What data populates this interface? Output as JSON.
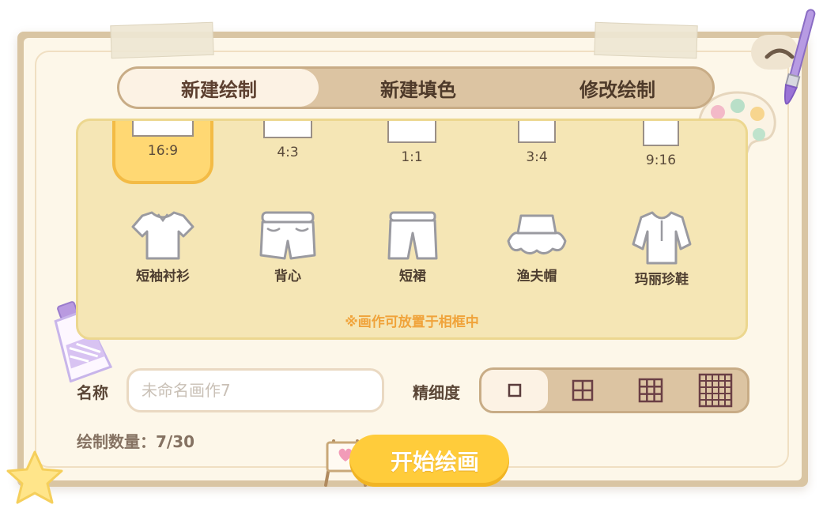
{
  "tabs": [
    {
      "label": "新建绘制",
      "active": true
    },
    {
      "label": "新建填色",
      "active": false
    },
    {
      "label": "修改绘制",
      "active": false
    }
  ],
  "ratios": [
    {
      "label": "16:9",
      "selected": true
    },
    {
      "label": "4:3",
      "selected": false
    },
    {
      "label": "1:1",
      "selected": false
    },
    {
      "label": "3:4",
      "selected": false
    },
    {
      "label": "9:16",
      "selected": false
    }
  ],
  "garments": [
    {
      "label": "短袖衬衫",
      "icon": "tshirt-icon"
    },
    {
      "label": "背心",
      "icon": "vest-icon"
    },
    {
      "label": "短裙",
      "icon": "shorts-icon"
    },
    {
      "label": "渔夫帽",
      "icon": "bucket-hat-icon"
    },
    {
      "label": "玛丽珍鞋",
      "icon": "blouse-icon"
    }
  ],
  "hint": "※画作可放置于相框中",
  "name": {
    "label": "名称",
    "placeholder": "未命名画作7",
    "value": ""
  },
  "detail": {
    "label": "精细度",
    "levels": [
      "1x1",
      "2x2",
      "3x3",
      "5x5"
    ],
    "selected_index": 0
  },
  "count": {
    "text": "绘制数量：7/30"
  },
  "start_button": {
    "label": "开始绘画"
  },
  "colors": {
    "accent": "#ffcc3b",
    "panel": "#f5e6b5",
    "tab_bg": "#dcc4a2",
    "hint": "#f0a33a"
  }
}
